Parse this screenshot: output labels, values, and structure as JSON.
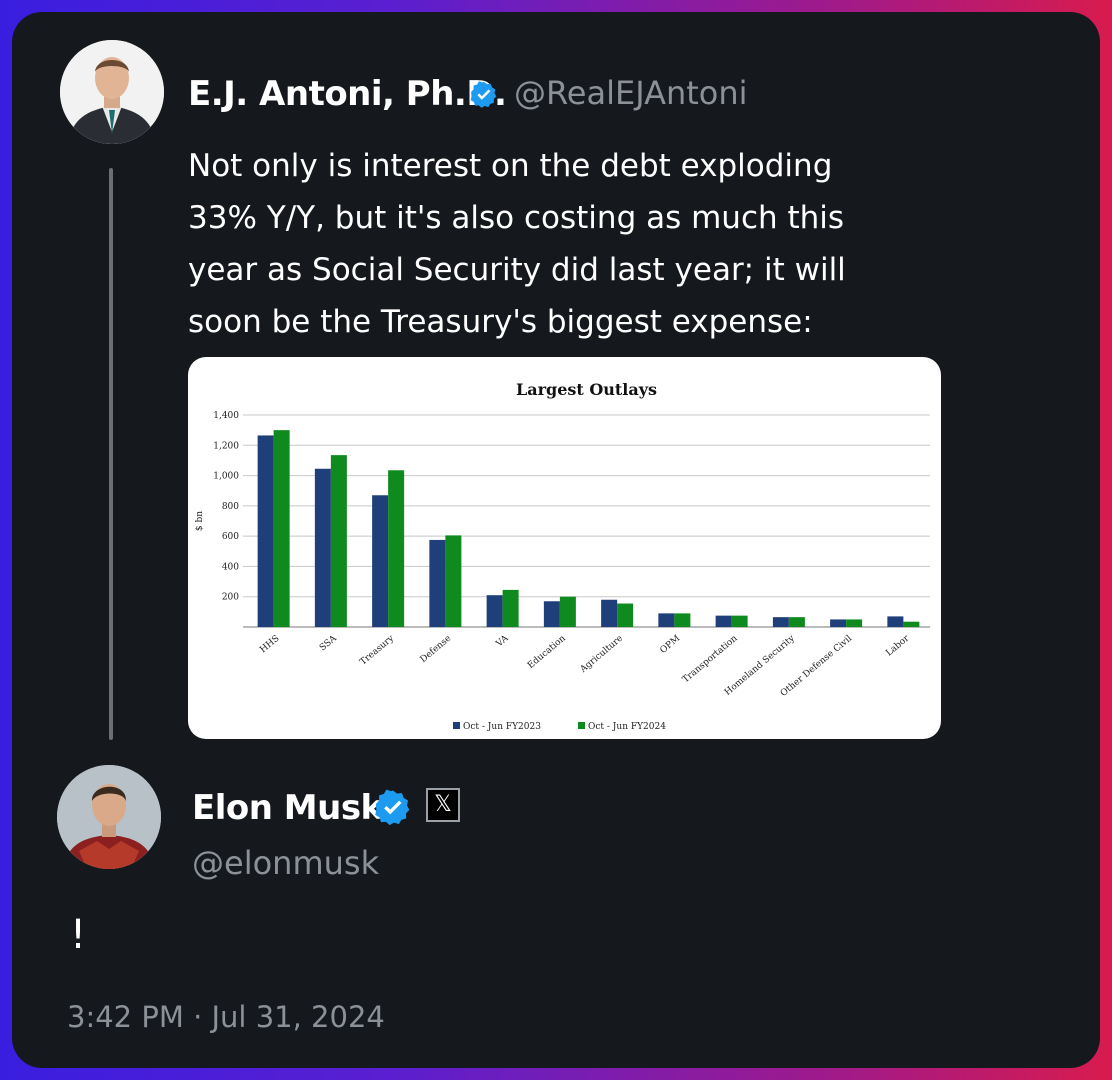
{
  "quoted_tweet": {
    "author_name": "E.J. Antoni, Ph.D.",
    "author_handle": "@RealEJAntoni",
    "verified_icon": "verified-badge-icon",
    "text_lines": [
      "Not only is interest on the debt exploding",
      "33% Y/Y, but it's also costing as much this",
      "year as Social Security did last year; it will",
      "soon be the Treasury's biggest expense:"
    ]
  },
  "reply_tweet": {
    "author_name": "Elon Musk",
    "author_handle": "@elonmusk",
    "verified_icon": "verified-badge-icon",
    "affiliate_icon": "x-logo-icon",
    "affiliate_glyph": "𝕏",
    "text": "!",
    "timestamp": "3:42 PM · Jul 31, 2024"
  },
  "colors": {
    "verified": "#1d9bf0",
    "series_2023": "#1f3f7a",
    "series_2024": "#0f8a1f"
  },
  "chart_data": {
    "type": "bar",
    "title": "Largest Outlays",
    "xlabel": "",
    "ylabel": "$ bn",
    "ylim": [
      0,
      1400
    ],
    "yticks": [
      "200",
      "400",
      "600",
      "800",
      "1,000",
      "1,200",
      "1,400"
    ],
    "grid": true,
    "legend_placement": "bottom",
    "categories": [
      "HHS",
      "SSA",
      "Treasury",
      "Defense",
      "VA",
      "Education",
      "Agriculture",
      "OPM",
      "Transportation",
      "Homeland Security",
      "Other Defense Civil",
      "Labor"
    ],
    "series": [
      {
        "name": "Oct - Jun FY2023",
        "values": [
          1265,
          1045,
          870,
          575,
          210,
          170,
          180,
          90,
          75,
          65,
          50,
          70
        ]
      },
      {
        "name": "Oct - Jun FY2024",
        "values": [
          1300,
          1135,
          1035,
          605,
          245,
          200,
          155,
          90,
          75,
          65,
          50,
          35
        ]
      }
    ]
  }
}
